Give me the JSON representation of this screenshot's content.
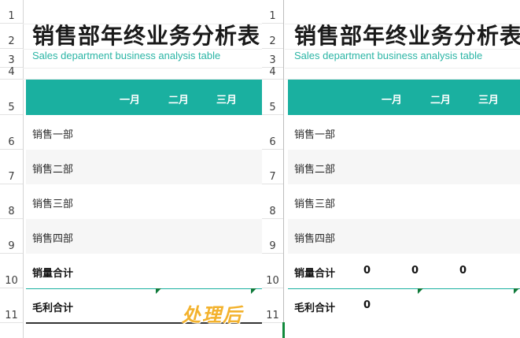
{
  "row_numbers": [
    "1",
    "2",
    "3",
    "4",
    "5",
    "6",
    "7",
    "8",
    "9",
    "10",
    "11"
  ],
  "title": "销售部年终业务分析表",
  "subtitle": "Sales department business analysis table",
  "months": [
    "一月",
    "二月",
    "三月"
  ],
  "rows": [
    "销售一部",
    "销售二部",
    "销售三部",
    "销售四部"
  ],
  "sales_total_label": "销量合计",
  "profit_total_label": "毛利合计",
  "after_values": {
    "sales_total": [
      "0",
      "0",
      "0"
    ],
    "profit_total": [
      "0"
    ]
  },
  "stamp_text": "处理后",
  "colors": {
    "accent": "#1ab0a0",
    "stamp": "#f3b22d",
    "marker": "#0f7a3a"
  }
}
